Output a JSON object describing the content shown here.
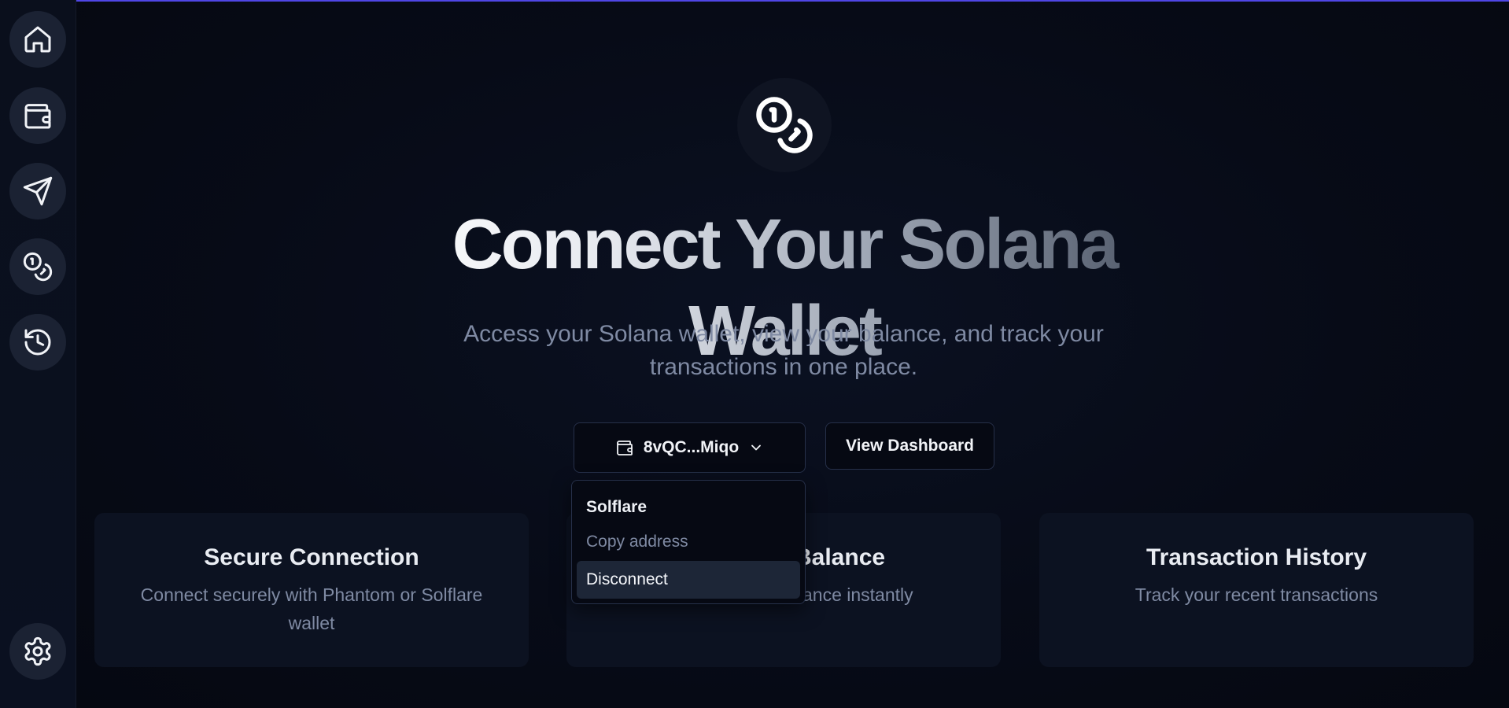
{
  "sidebar": {
    "items": [
      {
        "name": "home",
        "icon": "home-icon"
      },
      {
        "name": "wallet",
        "icon": "wallet-icon"
      },
      {
        "name": "send",
        "icon": "send-icon"
      },
      {
        "name": "coins",
        "icon": "coins-icon"
      },
      {
        "name": "history",
        "icon": "history-icon"
      }
    ],
    "settings_icon": "gear-icon"
  },
  "hero": {
    "icon": "coins-icon",
    "title": "Connect Your Solana Wallet",
    "subtitle": "Access your Solana wallet, view your balance, and track your transactions in one place."
  },
  "actions": {
    "wallet_button_label": "8vQC...Miqo",
    "dashboard_button_label": "View Dashboard"
  },
  "wallet_menu": {
    "header": "Solflare",
    "items": [
      "Copy address",
      "Disconnect"
    ],
    "active_item": "Disconnect"
  },
  "features": [
    {
      "title": "Secure Connection",
      "description": "Connect securely with Phantom or Solflare wallet"
    },
    {
      "title": "Balance",
      "description": "ance instantly"
    },
    {
      "title": "Transaction History",
      "description": "Track your recent transactions"
    }
  ],
  "colors": {
    "background": "#060913",
    "accent": "#4f46e5",
    "muted_text": "#7f8aa3"
  }
}
